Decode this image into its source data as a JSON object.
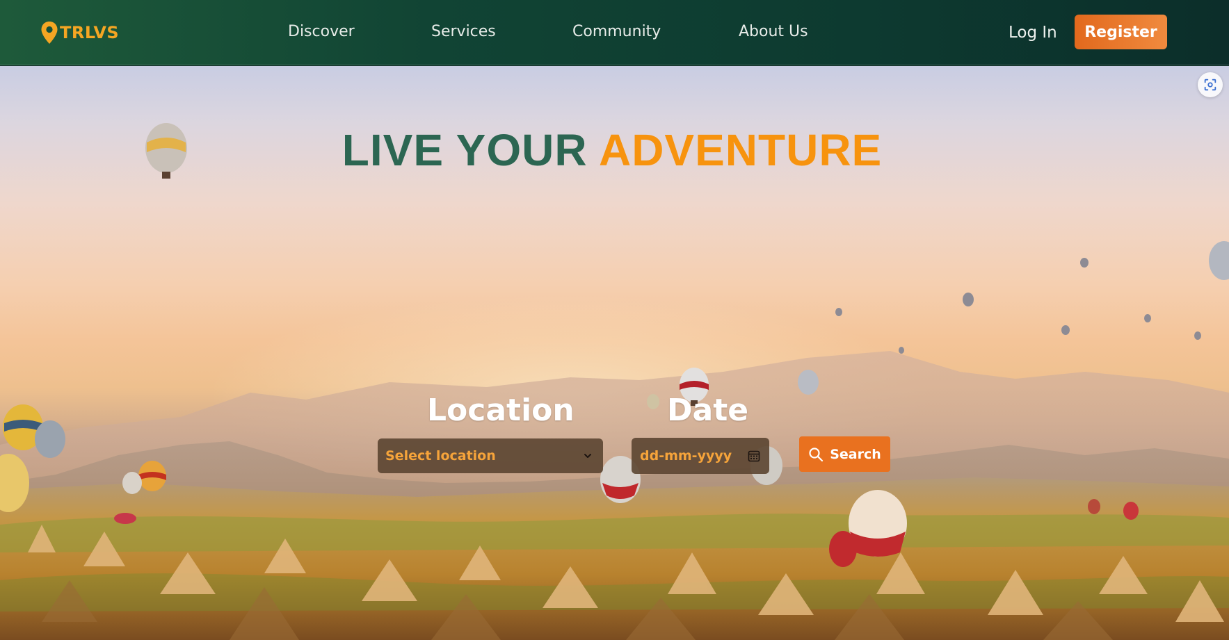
{
  "brand": {
    "name": "TRLVS",
    "color": "#f5a623"
  },
  "nav": {
    "links": [
      "Discover",
      "Services",
      "Community",
      "About Us"
    ],
    "login_label": "Log In",
    "register_label": "Register"
  },
  "hero": {
    "headline_part1": "LIVE YOUR",
    "headline_part2": "ADVENTURE",
    "location_label": "Location",
    "location_select_value": "Select location",
    "date_label": "Date",
    "date_placeholder": "dd-mm-yyyy",
    "search_label": "Search"
  },
  "icons": {
    "logo": "map-pin-icon",
    "select": "chevron-down-icon",
    "date": "calendar-icon",
    "search": "search-icon",
    "screenshot": "screenshot-capture-icon"
  },
  "colors": {
    "nav_bg": "#114434",
    "accent": "#e9711f",
    "headline_green": "#2c6652",
    "headline_orange": "#f7930e",
    "field_bg": "#5b4531",
    "field_text": "#f6a43a"
  }
}
